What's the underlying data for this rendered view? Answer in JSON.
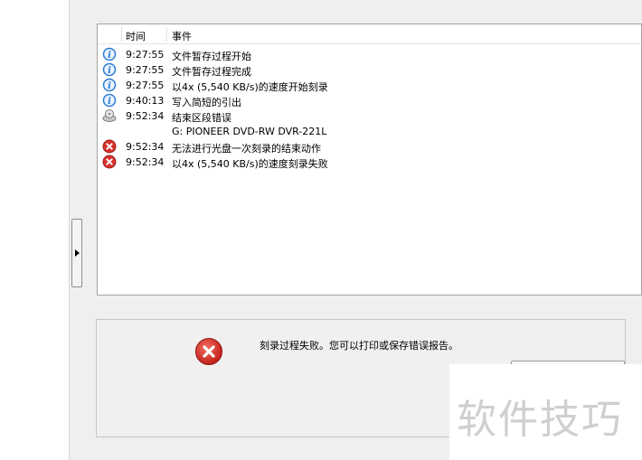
{
  "log": {
    "header": {
      "time": "时间",
      "event": "事件"
    },
    "rows": [
      {
        "icon": "info-icon",
        "time": "9:27:55",
        "event": "文件暂存过程开始"
      },
      {
        "icon": "info-icon",
        "time": "9:27:55",
        "event": "文件暂存过程完成"
      },
      {
        "icon": "info-icon",
        "time": "9:27:55",
        "event": "以4x (5,540 KB/s)的速度开始刻录"
      },
      {
        "icon": "info-icon",
        "time": "9:40:13",
        "event": "写入简短的引出"
      },
      {
        "icon": "drive-icon",
        "time": "9:52:34",
        "event": "结束区段错误"
      },
      {
        "icon": "",
        "time": "",
        "event": "G: PIONEER DVD-RW  DVR-221L"
      },
      {
        "icon": "error-icon",
        "time": "9:52:34",
        "event": "无法进行光盘一次刻录的结束动作"
      },
      {
        "icon": "error-icon",
        "time": "9:52:34",
        "event": "以4x (5,540 KB/s)的速度刻录失败"
      }
    ]
  },
  "message": {
    "text": "刻录过程失败。您可以打印或保存错误报告。",
    "icon": "error-icon"
  },
  "watermark": "软件技巧",
  "colors": {
    "error": "#d9302b",
    "info": "#2a7bd6",
    "panel_bg": "#efefef"
  }
}
